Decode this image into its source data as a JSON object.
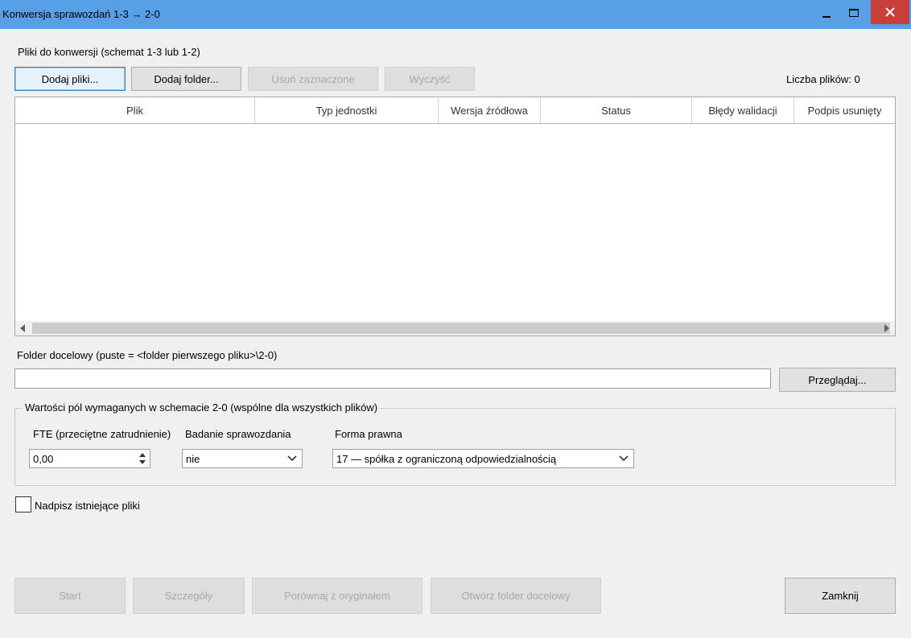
{
  "window": {
    "title": "Konwersja sprawozdań 1-3 → 2-0",
    "controls": [
      "minimize",
      "maximize",
      "close"
    ]
  },
  "files_section": {
    "label": "Pliki do konwersji (schemat 1-3 lub 1-2)",
    "buttons": {
      "add_files": "Dodaj pliki...",
      "add_folder": "Dodaj folder...",
      "remove_selected": "Usuń zaznaczone",
      "clear": "Wyczyść"
    },
    "file_count": "Liczba plików: 0"
  },
  "table": {
    "columns": [
      "Plik",
      "Typ jednostki",
      "Wersja źródłowa",
      "Status",
      "Błędy walidacji",
      "Podpis usunięty"
    ],
    "rows": []
  },
  "output_folder": {
    "label": "Folder docelowy (puste = <folder pierwszego pliku>\\2-0)",
    "value": "",
    "browse": "Przeglądaj..."
  },
  "required_fields": {
    "group_label": "Wartości pól wymaganych w schemacie 2-0 (wspólne dla wszystkich plików)",
    "fte_label": "FTE (przeciętne zatrudnienie)",
    "fte_value": "0,00",
    "audit_label": "Badanie sprawozdania",
    "audit_value": "nie",
    "legal_form_label": "Forma prawna",
    "legal_form_value": "17 — spółka z ograniczoną odpowiedzialnością"
  },
  "overwrite": {
    "label": "Nadpisz istniejące pliki",
    "checked": false
  },
  "footer": {
    "start": "Start",
    "details": "Szczegóły",
    "compare": "Porównaj z oryginałem",
    "open_folder": "Otwórz folder docelowy",
    "close": "Zamknij"
  }
}
